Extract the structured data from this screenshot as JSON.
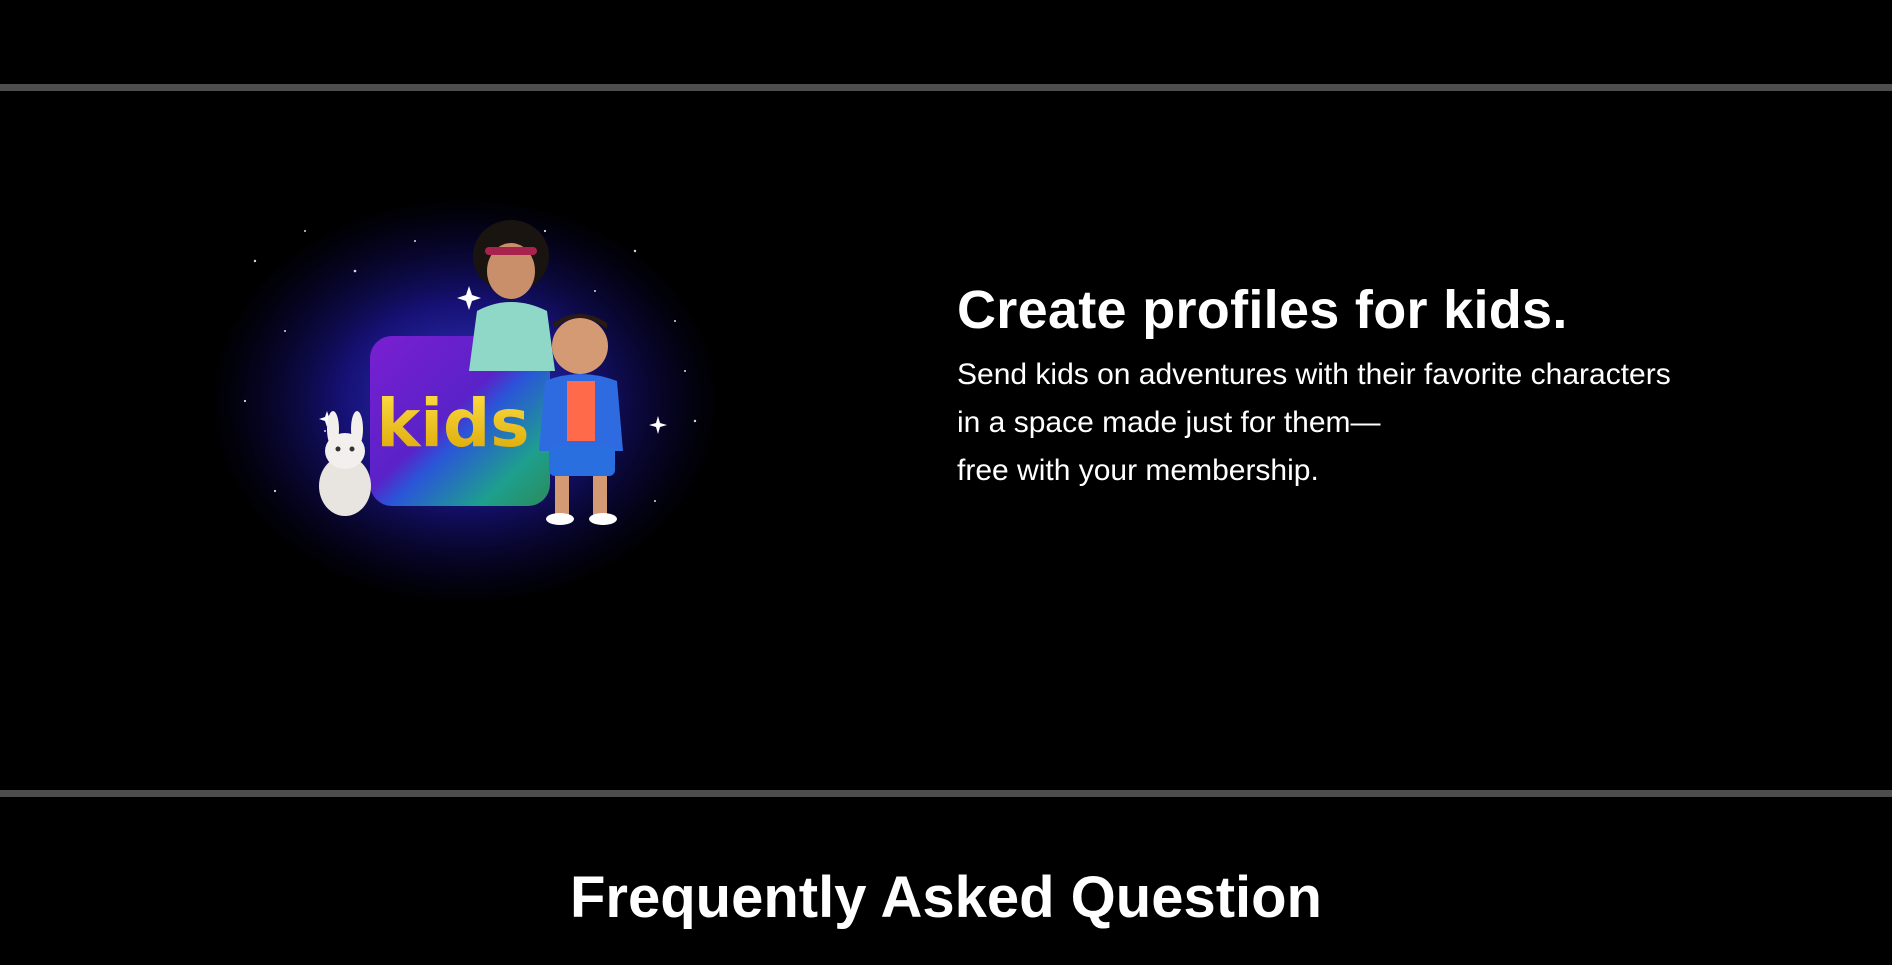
{
  "kids_section": {
    "headline": "Create profiles for kids.",
    "body_lines": [
      "Send kids on adventures with their favorite characters",
      "in a space made just for them—",
      "free with your membership."
    ],
    "illustration": {
      "badge_text": "kids",
      "icon": "kids-characters-illustration"
    }
  },
  "faq": {
    "title": "Frequently Asked Question"
  },
  "colors": {
    "background": "#000000",
    "divider": "#4d4d4d",
    "text": "#ffffff",
    "badge_purple": "#6a1fc4",
    "badge_blue": "#1f57d6",
    "badge_green": "#1fa87a",
    "badge_text": "#f2c200"
  }
}
